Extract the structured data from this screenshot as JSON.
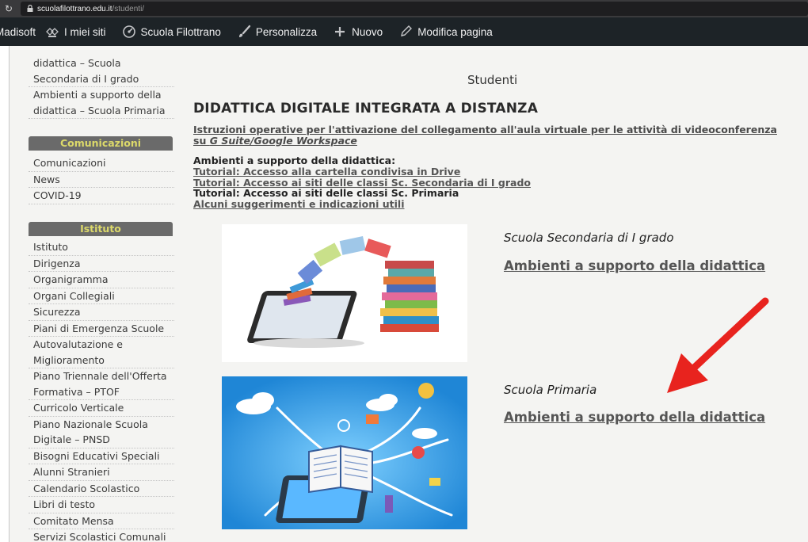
{
  "browser": {
    "reload_icon": "↻",
    "url_host": "scuolafilottrano.edu.it",
    "url_path": "/studenti/"
  },
  "admin_bar": {
    "items": [
      {
        "label": "Madisoft",
        "icon": ""
      },
      {
        "label": "I miei siti",
        "icon": "sites-icon"
      },
      {
        "label": "Scuola Filottrano",
        "icon": "dashboard-icon"
      },
      {
        "label": "Personalizza",
        "icon": "brush-icon"
      },
      {
        "label": "Nuovo",
        "icon": "plus-icon"
      },
      {
        "label": "Modifica pagina",
        "icon": "pencil-icon"
      }
    ]
  },
  "sidebar": {
    "top_links": [
      "didattica – Scuola",
      "Secondaria di I grado",
      "Ambienti a supporto della",
      "didattica – Scuola Primaria"
    ],
    "comunicazioni": {
      "header": "Comunicazioni",
      "links": [
        "Comunicazioni",
        "News",
        "COVID-19"
      ]
    },
    "istituto": {
      "header": "Istituto",
      "links": [
        "Istituto",
        "Dirigenza",
        "Organigramma",
        "Organi Collegiali",
        "Sicurezza",
        "Piani di Emergenza Scuole",
        "Autovalutazione e",
        "Miglioramento",
        "Piano Triennale dell'Offerta",
        "Formativa – PTOF",
        "Curricolo Verticale",
        "Piano Nazionale Scuola",
        "Digitale – PNSD",
        "Bisogni Educativi Speciali",
        "Alunni Stranieri",
        "Calendario Scolastico",
        "Libri di testo",
        "Comitato Mensa",
        "Servizi Scolastici Comunali"
      ]
    }
  },
  "main": {
    "page_title": "Studenti",
    "section_title": "DIDATTICA DIGITALE INTEGRATA A DISTANZA",
    "instructions_text": "Istruzioni operative per l'attivazione del collegamento all'aula virtuale per le attività di videoconferenza su ",
    "instructions_em": "G Suite/Google Workspace",
    "ambienti_label": "Ambienti a supporto della didattica:",
    "ambienti_links": [
      {
        "text": "Tutorial: Accesso alla cartella condivisa in Drive",
        "link": true
      },
      {
        "text": "Tutorial: Accesso ai siti delle classi Sc. Secondaria di I grado",
        "link": true
      },
      {
        "text": "Tutorial: Accesso ai siti delle classi Sc. Primaria",
        "link": false
      },
      {
        "text": "Alcuni suggerimenti e indicazioni utili",
        "link": true
      }
    ],
    "secondaria": {
      "label": "Scuola Secondaria di I grado",
      "link": "Ambienti a supporto della didattica"
    },
    "primaria": {
      "label": "Scuola Primaria",
      "link": "Ambienti a supporto della didattica"
    }
  },
  "colors": {
    "sidebar_header_bg": "#6a6a6a",
    "sidebar_header_text": "#dcd96a",
    "arrow": "#e8231e",
    "admin_bar_bg": "#1d2327"
  }
}
